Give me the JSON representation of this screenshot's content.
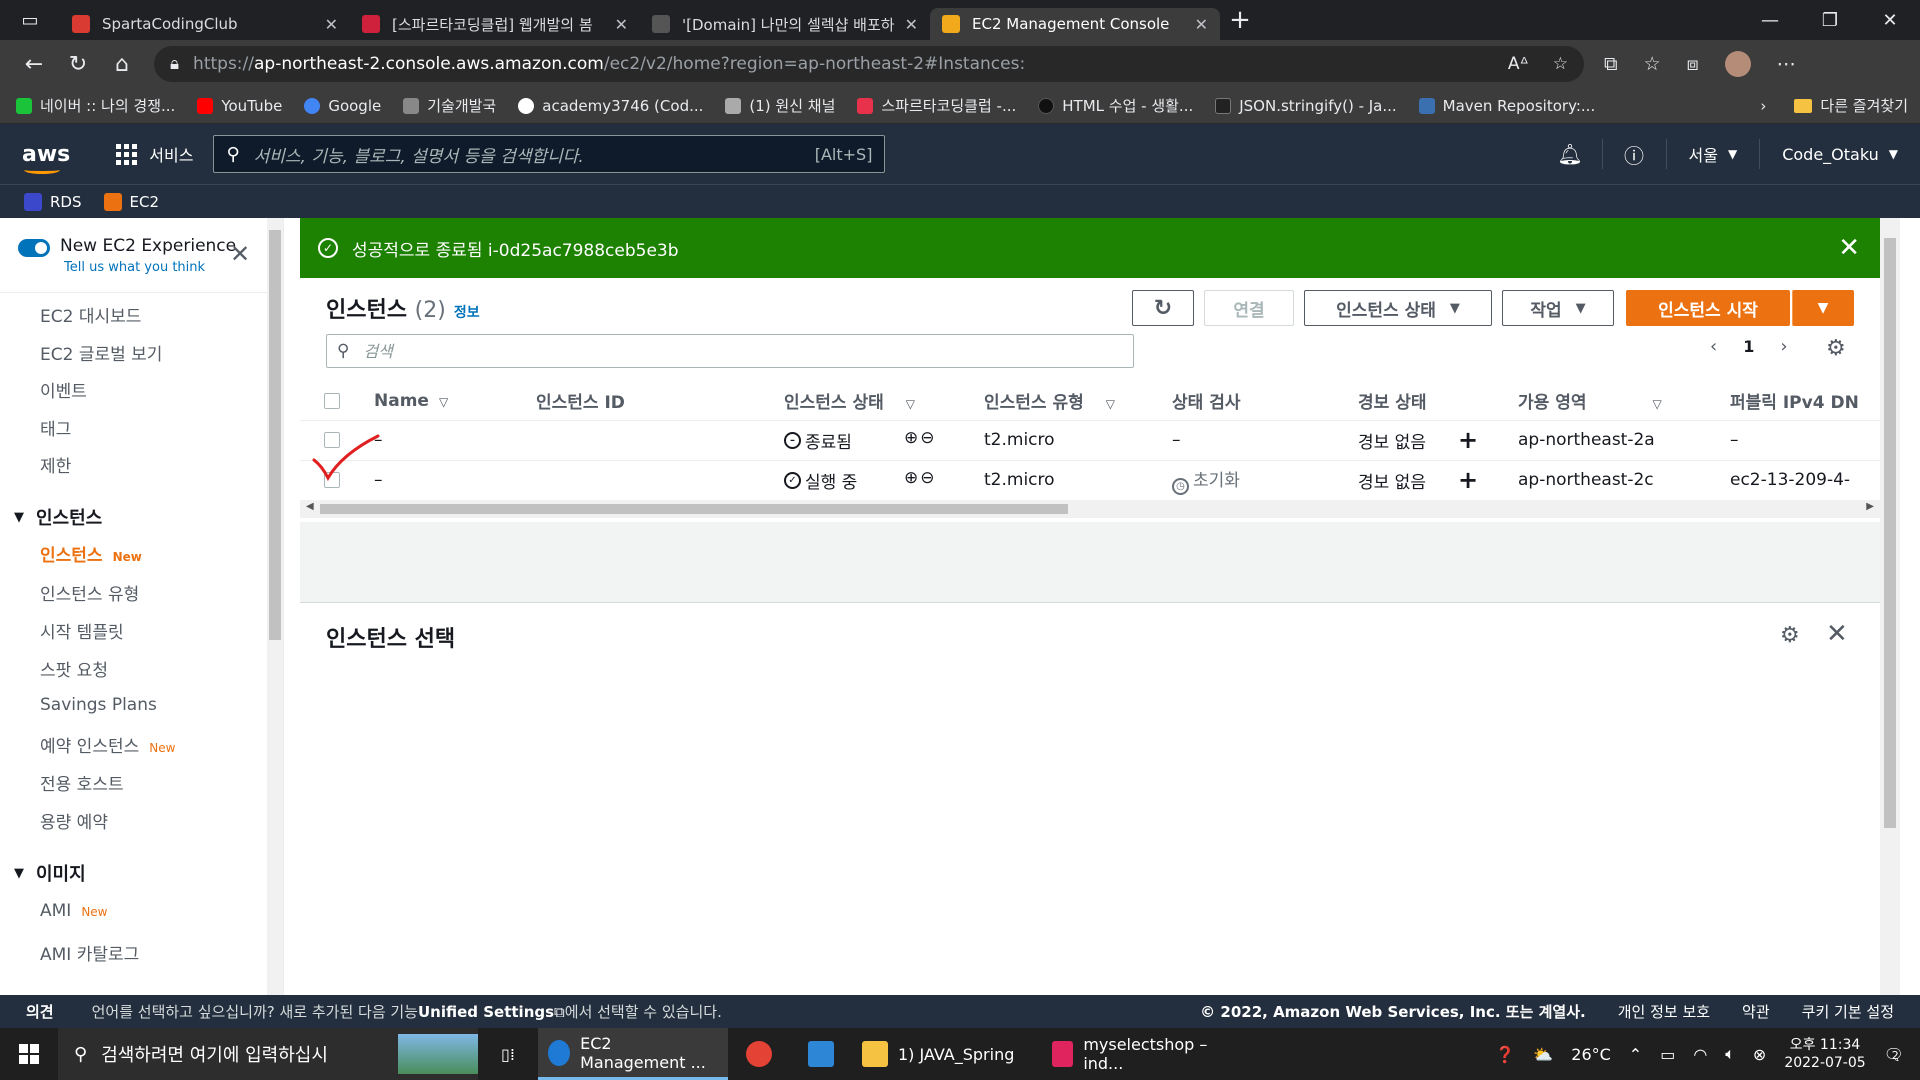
{
  "browser": {
    "tabs": [
      {
        "title": "SpartaCodingClub",
        "color": "#d93a32"
      },
      {
        "title": "[스파르타코딩클럽] 웹개발의 봄",
        "color": "#d0213c"
      },
      {
        "title": "'[Domain] 나만의 셀렉샵 배포하",
        "color": "#333333"
      },
      {
        "title": "EC2 Management Console",
        "color": "#f2a91b"
      }
    ],
    "url_prefix": "https://",
    "url_host": "ap-northeast-2.console.aws.amazon.com",
    "url_path": "/ec2/v2/home?region=ap-northeast-2#Instances:",
    "bookmarks": [
      {
        "label": "네이버 :: 나의 경쟁...",
        "color": "#19c43a"
      },
      {
        "label": "YouTube",
        "color": "#ff0000"
      },
      {
        "label": "Google",
        "color": "#4285f4"
      },
      {
        "label": "기술개발국",
        "color": "#888888"
      },
      {
        "label": "academy3746 (Cod...",
        "color": "#ffffff"
      },
      {
        "label": "(1) 원신 채널",
        "color": "#aaaaaa"
      },
      {
        "label": "스파르타코딩클럽 -...",
        "color": "#e8324b"
      },
      {
        "label": "HTML 수업 - 생활...",
        "color": "#111111"
      },
      {
        "label": "JSON.stringify() - Ja...",
        "color": "#222222"
      },
      {
        "label": "Maven Repository:...",
        "color": "#3a6fb0"
      }
    ],
    "other_bookmarks": "다른 즐겨찾기"
  },
  "aws_header": {
    "logo": "aws",
    "services": "서비스",
    "search_placeholder": "서비스, 기능, 블로그, 설명서 등을 검색합니다.",
    "search_shortcut": "[Alt+S]",
    "region": "서울",
    "account": "Code_Otaku",
    "favorites": [
      {
        "label": "RDS",
        "color": "#3b48cc"
      },
      {
        "label": "EC2",
        "color": "#ec7211"
      }
    ]
  },
  "sidebar": {
    "new_experience": "New EC2 Experience",
    "tell_us": "Tell us what you think",
    "new_badge": "New",
    "top_items": [
      "EC2 대시보드",
      "EC2 글로벌 보기",
      "이벤트",
      "태그",
      "제한"
    ],
    "group_instances": "인스턴스",
    "instance_items": [
      "인스턴스",
      "인스턴스 유형",
      "시작 템플릿",
      "스팟 요청",
      "Savings Plans",
      "예약 인스턴스",
      "전용 호스트",
      "용량 예약"
    ],
    "group_images": "이미지",
    "image_items": [
      "AMI",
      "AMI 카탈로그"
    ]
  },
  "flash": {
    "message": "성공적으로 종료됨 i-0d25ac7988ceb5e3b"
  },
  "instances": {
    "title": "인스턴스",
    "count": "(2)",
    "info": "정보",
    "buttons": {
      "connect": "연결",
      "state": "인스턴스 상태",
      "actions": "작업",
      "launch": "인스턴스 시작"
    },
    "search_placeholder": "검색",
    "page": "1",
    "columns": [
      "Name",
      "인스턴스 ID",
      "인스턴스 상태",
      "인스턴스 유형",
      "상태 검사",
      "경보 상태",
      "가용 영역",
      "퍼블릭 IPv4 DN"
    ],
    "rows": [
      {
        "name": "–",
        "id": "",
        "state": "종료됨",
        "type": "t2.micro",
        "check": "–",
        "alarm": "경보 없음",
        "az": "ap-northeast-2a",
        "dns": "–"
      },
      {
        "name": "–",
        "id": "",
        "state": "실행 중",
        "type": "t2.micro",
        "check": "초기화",
        "alarm": "경보 없음",
        "az": "ap-northeast-2c",
        "dns": "ec2-13-209-4-"
      }
    ],
    "colors": {
      "running": "#1d8102",
      "stopped": "#687078",
      "accent": "#ec7211",
      "flash": "#1d8102"
    }
  },
  "detail": {
    "title": "인스턴스 선택"
  },
  "footer": {
    "feedback": "의견",
    "msg_before": "언어를 선택하고 싶으십니까? 새로 추가된 다음 기능",
    "msg_link": "Unified Settings",
    "msg_after": "에서 선택할 수 있습니다.",
    "copyright": "© 2022, Amazon Web Services, Inc. 또는 계열사.",
    "privacy": "개인 정보 보호",
    "terms": "약관",
    "cookies": "쿠키 기본 설정"
  },
  "taskbar": {
    "search_placeholder": "검색하려면 여기에 입력하십시",
    "apps": [
      {
        "label": "EC2 Management ...",
        "color": "#1f7ad6",
        "active": true
      },
      {
        "label": "",
        "color": "#e34234",
        "active": false
      },
      {
        "label": "",
        "color": "#2e86d6",
        "active": false
      },
      {
        "label": "1) JAVA_Spring",
        "color": "#f5c242",
        "active": false
      },
      {
        "label": "myselectshop – ind...",
        "color": "#e0245e",
        "active": false
      }
    ],
    "temperature": "26°C",
    "time": "오후 11:34",
    "date": "2022-07-05",
    "notifications": "2"
  }
}
